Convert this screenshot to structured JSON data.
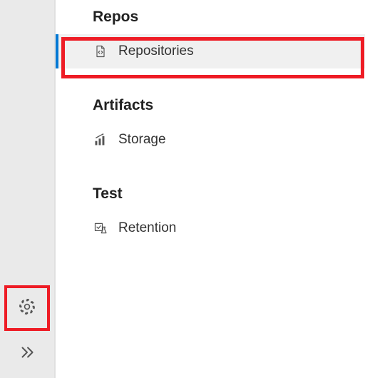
{
  "sections": [
    {
      "header": "Repos",
      "items": [
        {
          "label": "Repositories",
          "icon": "code-file-icon",
          "selected": true
        }
      ]
    },
    {
      "header": "Artifacts",
      "items": [
        {
          "label": "Storage",
          "icon": "chart-up-icon",
          "selected": false
        }
      ]
    },
    {
      "header": "Test",
      "items": [
        {
          "label": "Retention",
          "icon": "flask-check-icon",
          "selected": false
        }
      ]
    }
  ],
  "rail": {
    "settings": "Settings",
    "expand": "Expand"
  }
}
